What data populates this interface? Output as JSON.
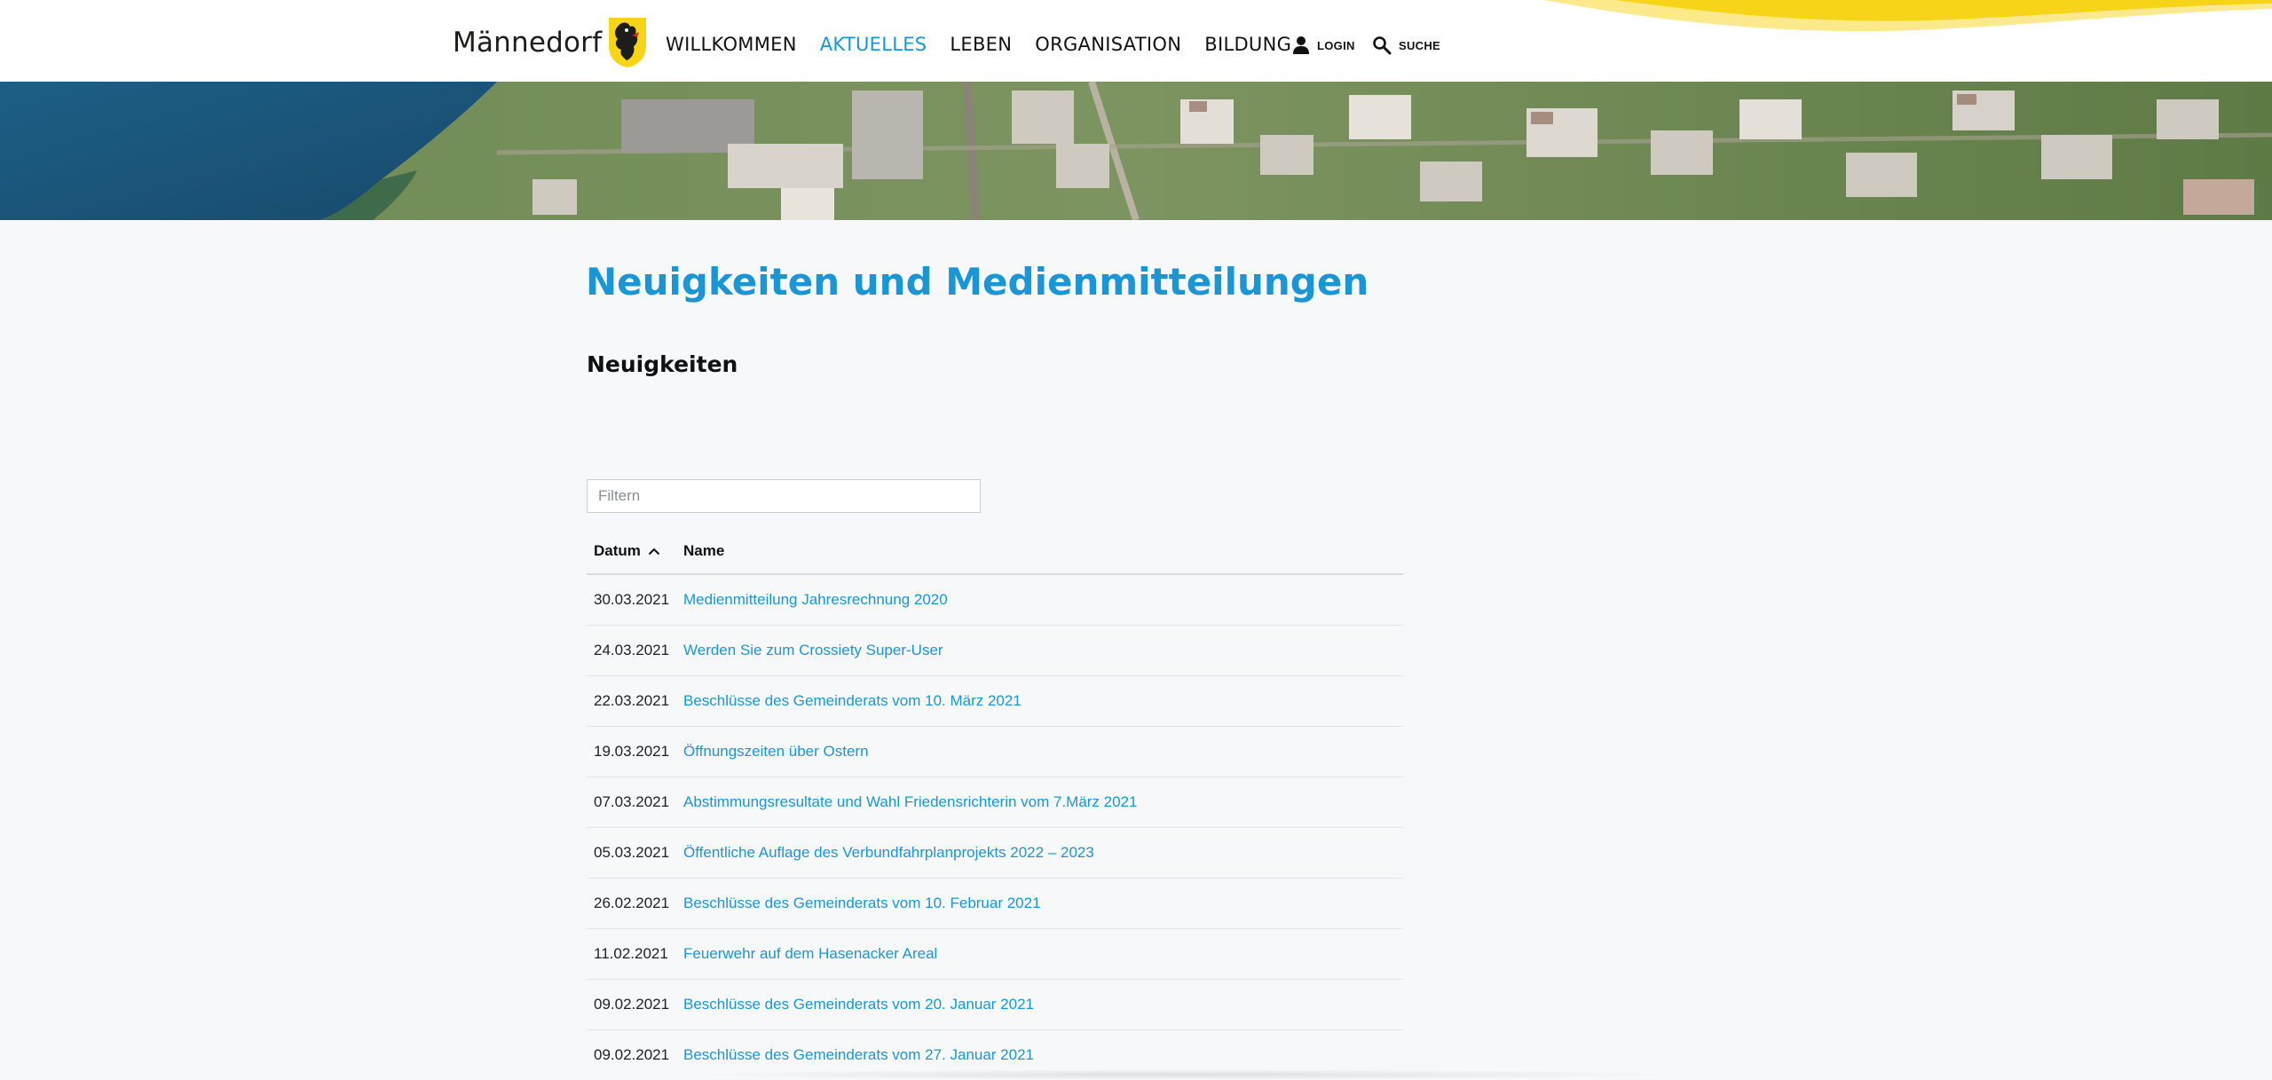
{
  "header": {
    "brand_name": "Männedorf",
    "nav": [
      "WILLKOMMEN",
      "AKTUELLES",
      "LEBEN",
      "ORGANISATION",
      "BILDUNG"
    ],
    "active_nav": "AKTUELLES",
    "login_label": "LOGIN",
    "search_label": "SUCHE"
  },
  "main": {
    "title": "Neuigkeiten und Medienmitteilungen",
    "section_title": "Neuigkeiten",
    "filter_placeholder": "Filtern",
    "columns": {
      "date": "Datum",
      "name": "Name"
    },
    "rows": [
      {
        "date": "30.03.2021",
        "name": "Medienmitteilung Jahresrechnung 2020"
      },
      {
        "date": "24.03.2021",
        "name": "Werden Sie zum Crossiety Super-User"
      },
      {
        "date": "22.03.2021",
        "name": "Beschlüsse des Gemeinderats vom 10. März 2021"
      },
      {
        "date": "19.03.2021",
        "name": "Öffnungszeiten über Ostern"
      },
      {
        "date": "07.03.2021",
        "name": "Abstimmungsresultate und Wahl Friedensrichterin vom 7.März 2021"
      },
      {
        "date": "05.03.2021",
        "name": "Öffentliche Auflage des Verbundfahrplanprojekts 2022 – 2023"
      },
      {
        "date": "26.02.2021",
        "name": "Beschlüsse des Gemeinderats vom 10. Februar 2021"
      },
      {
        "date": "11.02.2021",
        "name": "Feuerwehr auf dem Hasenacker Areal"
      },
      {
        "date": "09.02.2021",
        "name": "Beschlüsse des Gemeinderats vom 20. Januar 2021"
      },
      {
        "date": "09.02.2021",
        "name": "Beschlüsse des Gemeinderats vom 27. Januar 2021"
      }
    ]
  },
  "colors": {
    "accent": "#1a96d4",
    "brand_yellow": "#f7d417"
  },
  "icons": {
    "login": "user-icon",
    "search": "search-icon",
    "sort": "chevron-up-icon"
  }
}
